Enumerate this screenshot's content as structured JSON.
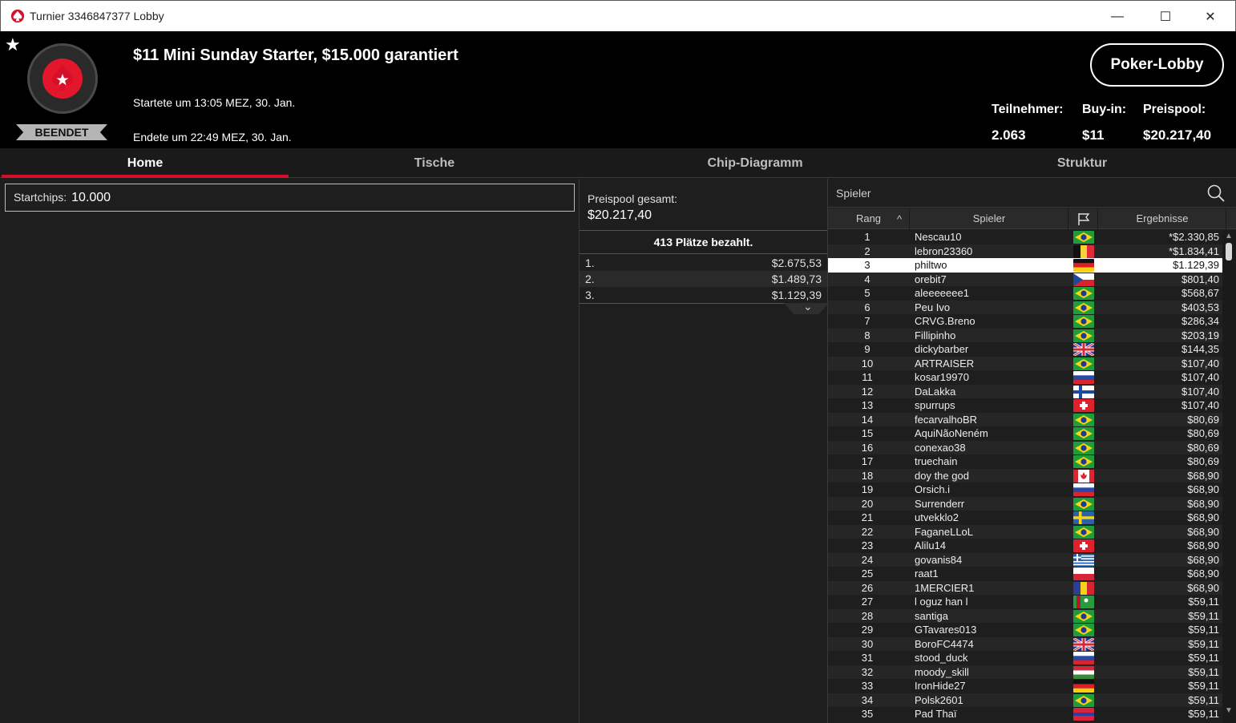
{
  "window": {
    "title": "Turnier 3346847377 Lobby",
    "min": "—",
    "max": "☐",
    "close": "✕"
  },
  "header": {
    "favorite": "★",
    "badge": "BEENDET",
    "name": "$11 Mini Sunday Starter, $15.000 garantiert",
    "started": "Startete um 13:05 MEZ, 30. Jan.",
    "ended": "Endete um 22:49 MEZ, 30. Jan.",
    "lobby_button": "Poker-Lobby",
    "stats": {
      "participants_label": "Teilnehmer:",
      "participants": "2.063",
      "buyin_label": "Buy-in:",
      "buyin": "$11",
      "prizepool_label": "Preispool:",
      "prizepool": "$20.217,40"
    }
  },
  "tabs": [
    "Home",
    "Tische",
    "Chip-Diagramm",
    "Struktur"
  ],
  "left": {
    "startchips_label": "Startchips:",
    "startchips_value": "10.000"
  },
  "prizes": {
    "total_label": "Preispool gesamt:",
    "total_value": "$20.217,40",
    "paid": "413 Plätze bezahlt.",
    "list": [
      {
        "pos": "1.",
        "amount": "$2.675,53"
      },
      {
        "pos": "2.",
        "amount": "$1.489,73"
      },
      {
        "pos": "3.",
        "amount": "$1.129,39"
      }
    ],
    "more": "⌄"
  },
  "players": {
    "search_placeholder": "Spieler",
    "columns": {
      "rank": "Rang",
      "sort": "^",
      "player": "Spieler",
      "results": "Ergebnisse"
    },
    "selected_rank": 3,
    "scroll_up": "▲",
    "scroll_down": "▼",
    "rows": [
      {
        "rank": "1",
        "player": "Nescau10",
        "flag": "br",
        "result": "*$2.330,85"
      },
      {
        "rank": "2",
        "player": "lebron23360",
        "flag": "be",
        "result": "*$1.834,41"
      },
      {
        "rank": "3",
        "player": "philtwo",
        "flag": "de",
        "result": "$1.129,39"
      },
      {
        "rank": "4",
        "player": "orebit7",
        "flag": "cz",
        "result": "$801,40"
      },
      {
        "rank": "5",
        "player": "aleeeeeee1",
        "flag": "br",
        "result": "$568,67"
      },
      {
        "rank": "6",
        "player": "Peu Ivo",
        "flag": "br",
        "result": "$403,53"
      },
      {
        "rank": "7",
        "player": "CRVG.Breno",
        "flag": "br",
        "result": "$286,34"
      },
      {
        "rank": "8",
        "player": "Fillipinho",
        "flag": "br",
        "result": "$203,19"
      },
      {
        "rank": "9",
        "player": "dickybarber",
        "flag": "gb",
        "result": "$144,35"
      },
      {
        "rank": "10",
        "player": "ARTRAISER",
        "flag": "br",
        "result": "$107,40"
      },
      {
        "rank": "11",
        "player": "kosar19970",
        "flag": "ru",
        "result": "$107,40"
      },
      {
        "rank": "12",
        "player": "DaLakka",
        "flag": "fi",
        "result": "$107,40"
      },
      {
        "rank": "13",
        "player": "spurrups",
        "flag": "ch",
        "result": "$107,40"
      },
      {
        "rank": "14",
        "player": "fecarvalhoBR",
        "flag": "br",
        "result": "$80,69"
      },
      {
        "rank": "15",
        "player": "AquiNãoNeném",
        "flag": "br",
        "result": "$80,69"
      },
      {
        "rank": "16",
        "player": "conexao38",
        "flag": "br",
        "result": "$80,69"
      },
      {
        "rank": "17",
        "player": "truechain",
        "flag": "br",
        "result": "$80,69"
      },
      {
        "rank": "18",
        "player": "doy the god",
        "flag": "ca",
        "result": "$68,90"
      },
      {
        "rank": "19",
        "player": "Orsich.i",
        "flag": "ru",
        "result": "$68,90"
      },
      {
        "rank": "20",
        "player": "Surrenderr",
        "flag": "br",
        "result": "$68,90"
      },
      {
        "rank": "21",
        "player": "utvekklo2",
        "flag": "se",
        "result": "$68,90"
      },
      {
        "rank": "22",
        "player": "FaganeLLoL",
        "flag": "br",
        "result": "$68,90"
      },
      {
        "rank": "23",
        "player": "Alilu14",
        "flag": "ch",
        "result": "$68,90"
      },
      {
        "rank": "24",
        "player": "govanis84",
        "flag": "gr",
        "result": "$68,90"
      },
      {
        "rank": "25",
        "player": "raat1",
        "flag": "pl",
        "result": "$68,90"
      },
      {
        "rank": "26",
        "player": "1MERCIER1",
        "flag": "ro",
        "result": "$68,90"
      },
      {
        "rank": "27",
        "player": "l oguz han l",
        "flag": "tm",
        "result": "$59,11"
      },
      {
        "rank": "28",
        "player": "santiga",
        "flag": "br",
        "result": "$59,11"
      },
      {
        "rank": "29",
        "player": "GTavares013",
        "flag": "br",
        "result": "$59,11"
      },
      {
        "rank": "30",
        "player": "BoroFC4474",
        "flag": "gb",
        "result": "$59,11"
      },
      {
        "rank": "31",
        "player": "stood_duck",
        "flag": "ru",
        "result": "$59,11"
      },
      {
        "rank": "32",
        "player": "moody_skill",
        "flag": "hu",
        "result": "$59,11"
      },
      {
        "rank": "33",
        "player": "IronHide27",
        "flag": "de",
        "result": "$59,11"
      },
      {
        "rank": "34",
        "player": "Polsk2601",
        "flag": "br",
        "result": "$59,11"
      },
      {
        "rank": "35",
        "player": "Pad Thaï",
        "flag": "jbl",
        "result": "$59,11"
      }
    ]
  },
  "colors": {
    "accent": "#d4102a",
    "background": "#1e1e1e",
    "header": "#000000"
  }
}
